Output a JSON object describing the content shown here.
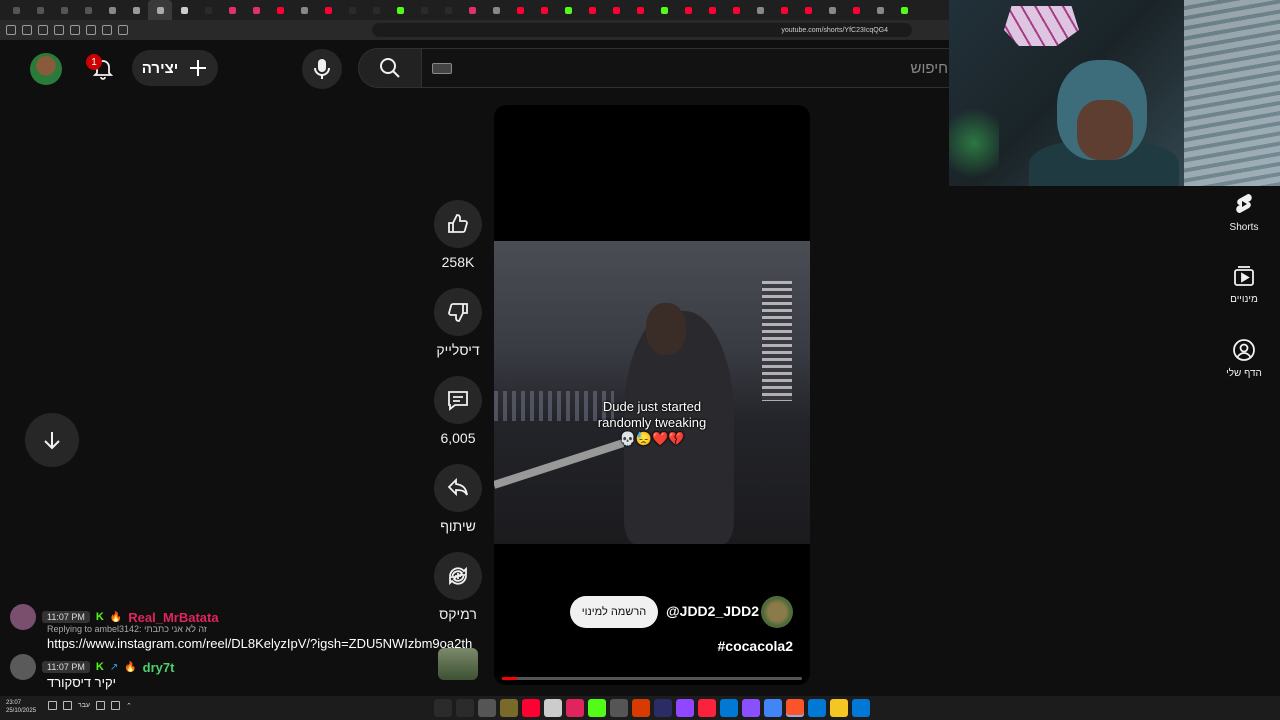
{
  "browser": {
    "address": "youtube.com/shorts/YfC23IcqQG4",
    "tab_colors": [
      "#555555",
      "#555555",
      "#555555",
      "#555555",
      "#888888",
      "#999999",
      "#aaaaaa",
      "#cccccc",
      "#2b2b2b",
      "#e1306c",
      "#e1306c",
      "#ff0033",
      "#888888",
      "#ff0033",
      "#2b2b2b",
      "#2b2b2b",
      "#53fc18",
      "#2b2b2b",
      "#2b2b2b",
      "#e1306c",
      "#888888",
      "#ff0033",
      "#ff0033",
      "#53fc18",
      "#ff0033",
      "#ff0033",
      "#ff0033",
      "#53fc18",
      "#ff0033",
      "#ff0033",
      "#ff0033",
      "#888888",
      "#ff0033",
      "#ff0033",
      "#888888",
      "#ff0033",
      "#888888",
      "#53fc18"
    ]
  },
  "header": {
    "notification_count": "1",
    "create_label": "יצירה",
    "search_placeholder": "חיפוש"
  },
  "sidebar_right": {
    "items": [
      {
        "label": "Shorts",
        "icon": "shorts-icon"
      },
      {
        "label": "מינויים",
        "icon": "subscriptions-icon"
      },
      {
        "label": "הדף שלי",
        "icon": "account-icon"
      }
    ]
  },
  "short": {
    "caption_line1": "Dude just started",
    "caption_line2": "randomly tweaking",
    "caption_emoji": "💀😓❤️💔",
    "subscribe_label": "הרשמה למינוי",
    "channel_handle": "@JDD2_JDD2",
    "hashtag": "#cocacola2",
    "progress": 0.05
  },
  "actions": {
    "like_count": "258K",
    "dislike_label": "דיסלייק",
    "comment_count": "6,005",
    "share_label": "שיתוף",
    "remix_label": "רמיקס"
  },
  "chat": {
    "msg1": {
      "time": "11:07 PM",
      "user": "Real_MrBatata",
      "reply": "Replying to ambel3142: זה לא אני כתבתי",
      "text": "https://www.instagram.com/reel/DL8KelyzIpV/?igsh=ZDU5NWIzbm9oa2th"
    },
    "msg2": {
      "time": "11:07 PM",
      "user": "dry7t",
      "text": "יקיר דיסקורד"
    }
  },
  "taskbar": {
    "time": "23:07",
    "date": "25/10/2025",
    "lang": "עבר",
    "app_colors": [
      "#2b2b2b",
      "#2b2b2b",
      "#555555",
      "#7a6a2a",
      "#ff0033",
      "#cccccc",
      "#e0245e",
      "#53fc18",
      "#555555",
      "#d83b01",
      "#2b2b66",
      "#9146ff",
      "#fa233b",
      "#0078d4",
      "#8a4fff",
      "#4285f4",
      "#fb542b",
      "#0078d4",
      "#f3c623",
      "#0078d4"
    ]
  }
}
